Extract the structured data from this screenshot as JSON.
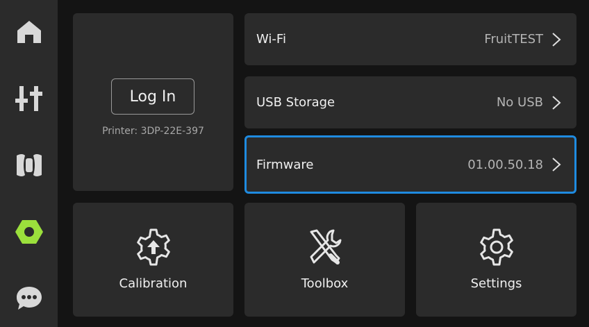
{
  "sidebar": {
    "items": [
      {
        "icon": "home-icon",
        "active": false
      },
      {
        "icon": "sliders-icon",
        "active": false
      },
      {
        "icon": "filament-spool-icon",
        "active": false
      },
      {
        "icon": "hex-nut-icon",
        "active": true
      },
      {
        "icon": "chat-bubble-icon",
        "active": false
      }
    ],
    "active_color": "#9be03c",
    "icon_color": "#d8d8d8"
  },
  "login": {
    "button_label": "Log In",
    "printer_label": "Printer: 3DP-22E-397"
  },
  "rows": [
    {
      "label": "Wi-Fi",
      "value": "FruitTEST"
    },
    {
      "label": "USB Storage",
      "value": "No USB"
    },
    {
      "label": "Firmware",
      "value": "01.00.50.18"
    }
  ],
  "tiles": [
    {
      "label": "Calibration",
      "icon": "calibration-gear-icon"
    },
    {
      "label": "Toolbox",
      "icon": "tools-icon"
    },
    {
      "label": "Settings",
      "icon": "settings-gear-icon"
    }
  ],
  "colors": {
    "highlight": "#1f8be0",
    "card": "#2b2b2b",
    "background": "#141414"
  }
}
